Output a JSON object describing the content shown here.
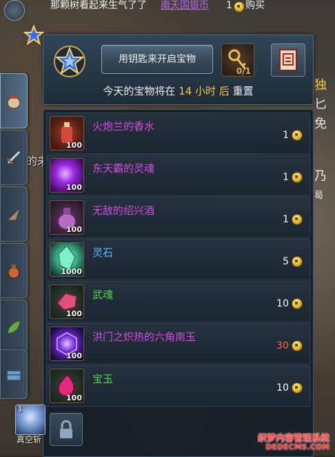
{
  "top_strip": {
    "prefix": "那颗树看起来生气了了",
    "shop_link": "南天国银币",
    "count": "1",
    "buy_label": "购买"
  },
  "header": {
    "open_button_label": "用钥匙来开启宝物",
    "key_count": "0/1",
    "reset_prefix": "今天的宝物将在",
    "reset_hours": "14 小时 后",
    "reset_suffix": "重置"
  },
  "tabs": [
    {
      "icon": "pouch-icon",
      "active": true
    },
    {
      "icon": "sword-icon",
      "active": false
    },
    {
      "icon": "arrow-icon",
      "active": false
    },
    {
      "icon": "potion-icon",
      "active": false
    },
    {
      "icon": "leaf-icon",
      "active": false
    },
    {
      "icon": "chest-icon",
      "active": false
    }
  ],
  "items": [
    {
      "name": "火炮兰的香水",
      "qty": "100",
      "price": "1",
      "name_color": "#d44ce0",
      "price_color": "#ffffff",
      "icon": "perfume-icon"
    },
    {
      "name": "东天霸的灵魂",
      "qty": "100",
      "price": "1",
      "name_color": "#d44ce0",
      "price_color": "#ffffff",
      "icon": "soul-orb-icon"
    },
    {
      "name": "无敌的绍兴酒",
      "qty": "100",
      "price": "1",
      "name_color": "#d44ce0",
      "price_color": "#ffffff",
      "icon": "wine-jar-icon"
    },
    {
      "name": "灵石",
      "qty": "1000",
      "price": "5",
      "name_color": "#5ab8ff",
      "price_color": "#ffffff",
      "icon": "spirit-stone-icon"
    },
    {
      "name": "武魂",
      "qty": "100",
      "price": "10",
      "name_color": "#4ed24e",
      "price_color": "#ffffff",
      "icon": "martial-soul-icon"
    },
    {
      "name": "洪门之炽热的六角南玉",
      "qty": "100",
      "price": "30",
      "name_color": "#d44ce0",
      "price_color": "#ff6a3a",
      "icon": "hex-jade-icon"
    },
    {
      "name": "宝玉",
      "qty": "100",
      "price": "10",
      "name_color": "#4ed24e",
      "price_color": "#ffffff",
      "icon": "gem-icon"
    }
  ],
  "avatar": {
    "label": "真空斩",
    "num": "1"
  },
  "right_edge_chars": [
    "独",
    "匕免",
    "乃",
    "曷"
  ],
  "left_strip_text": "的未",
  "watermark": {
    "line1": "织梦内容管理系统",
    "line2": "DEDECMS.COM"
  }
}
